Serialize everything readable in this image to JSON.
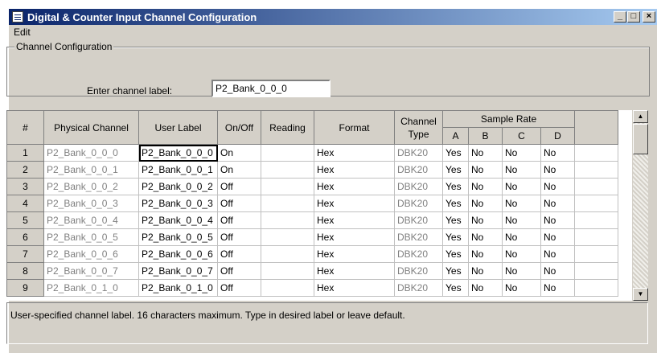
{
  "window": {
    "title": "Digital & Counter Input Channel Configuration",
    "minimize": "_",
    "maximize": "□",
    "close": "×"
  },
  "menu": {
    "edit": "Edit"
  },
  "channel_config": {
    "group_title": "Channel Configuration",
    "prompt": "Enter channel label:",
    "value": "P2_Bank_0_0_0"
  },
  "columns": {
    "num": "#",
    "physical": "Physical Channel",
    "user_label": "User Label",
    "on_off": "On/Off",
    "reading": "Reading",
    "format": "Format",
    "channel_type": "Channel Type",
    "sample_rate": "Sample Rate",
    "a": "A",
    "b": "B",
    "c": "C",
    "d": "D"
  },
  "rows": [
    {
      "num": "1",
      "physical": "P2_Bank_0_0_0",
      "user_label": "P2_Bank_0_0_0",
      "on_off": "On",
      "reading": "",
      "format": "Hex",
      "channel_type": "DBK20",
      "a": "Yes",
      "b": "No",
      "c": "No",
      "d": "No"
    },
    {
      "num": "2",
      "physical": "P2_Bank_0_0_1",
      "user_label": "P2_Bank_0_0_1",
      "on_off": "On",
      "reading": "",
      "format": "Hex",
      "channel_type": "DBK20",
      "a": "Yes",
      "b": "No",
      "c": "No",
      "d": "No"
    },
    {
      "num": "3",
      "physical": "P2_Bank_0_0_2",
      "user_label": "P2_Bank_0_0_2",
      "on_off": "Off",
      "reading": "",
      "format": "Hex",
      "channel_type": "DBK20",
      "a": "Yes",
      "b": "No",
      "c": "No",
      "d": "No"
    },
    {
      "num": "4",
      "physical": "P2_Bank_0_0_3",
      "user_label": "P2_Bank_0_0_3",
      "on_off": "Off",
      "reading": "",
      "format": "Hex",
      "channel_type": "DBK20",
      "a": "Yes",
      "b": "No",
      "c": "No",
      "d": "No"
    },
    {
      "num": "5",
      "physical": "P2_Bank_0_0_4",
      "user_label": "P2_Bank_0_0_4",
      "on_off": "Off",
      "reading": "",
      "format": "Hex",
      "channel_type": "DBK20",
      "a": "Yes",
      "b": "No",
      "c": "No",
      "d": "No"
    },
    {
      "num": "6",
      "physical": "P2_Bank_0_0_5",
      "user_label": "P2_Bank_0_0_5",
      "on_off": "Off",
      "reading": "",
      "format": "Hex",
      "channel_type": "DBK20",
      "a": "Yes",
      "b": "No",
      "c": "No",
      "d": "No"
    },
    {
      "num": "7",
      "physical": "P2_Bank_0_0_6",
      "user_label": "P2_Bank_0_0_6",
      "on_off": "Off",
      "reading": "",
      "format": "Hex",
      "channel_type": "DBK20",
      "a": "Yes",
      "b": "No",
      "c": "No",
      "d": "No"
    },
    {
      "num": "8",
      "physical": "P2_Bank_0_0_7",
      "user_label": "P2_Bank_0_0_7",
      "on_off": "Off",
      "reading": "",
      "format": "Hex",
      "channel_type": "DBK20",
      "a": "Yes",
      "b": "No",
      "c": "No",
      "d": "No"
    },
    {
      "num": "9",
      "physical": "P2_Bank_0_1_0",
      "user_label": "P2_Bank_0_1_0",
      "on_off": "Off",
      "reading": "",
      "format": "Hex",
      "channel_type": "DBK20",
      "a": "Yes",
      "b": "No",
      "c": "No",
      "d": "No"
    }
  ],
  "status": {
    "text": "User-specified channel label. 16 characters maximum. Type in desired label or leave default."
  },
  "icons": {
    "app": "grid-window-icon",
    "scroll_up": "arrow-up-icon",
    "scroll_down": "arrow-down-icon"
  }
}
